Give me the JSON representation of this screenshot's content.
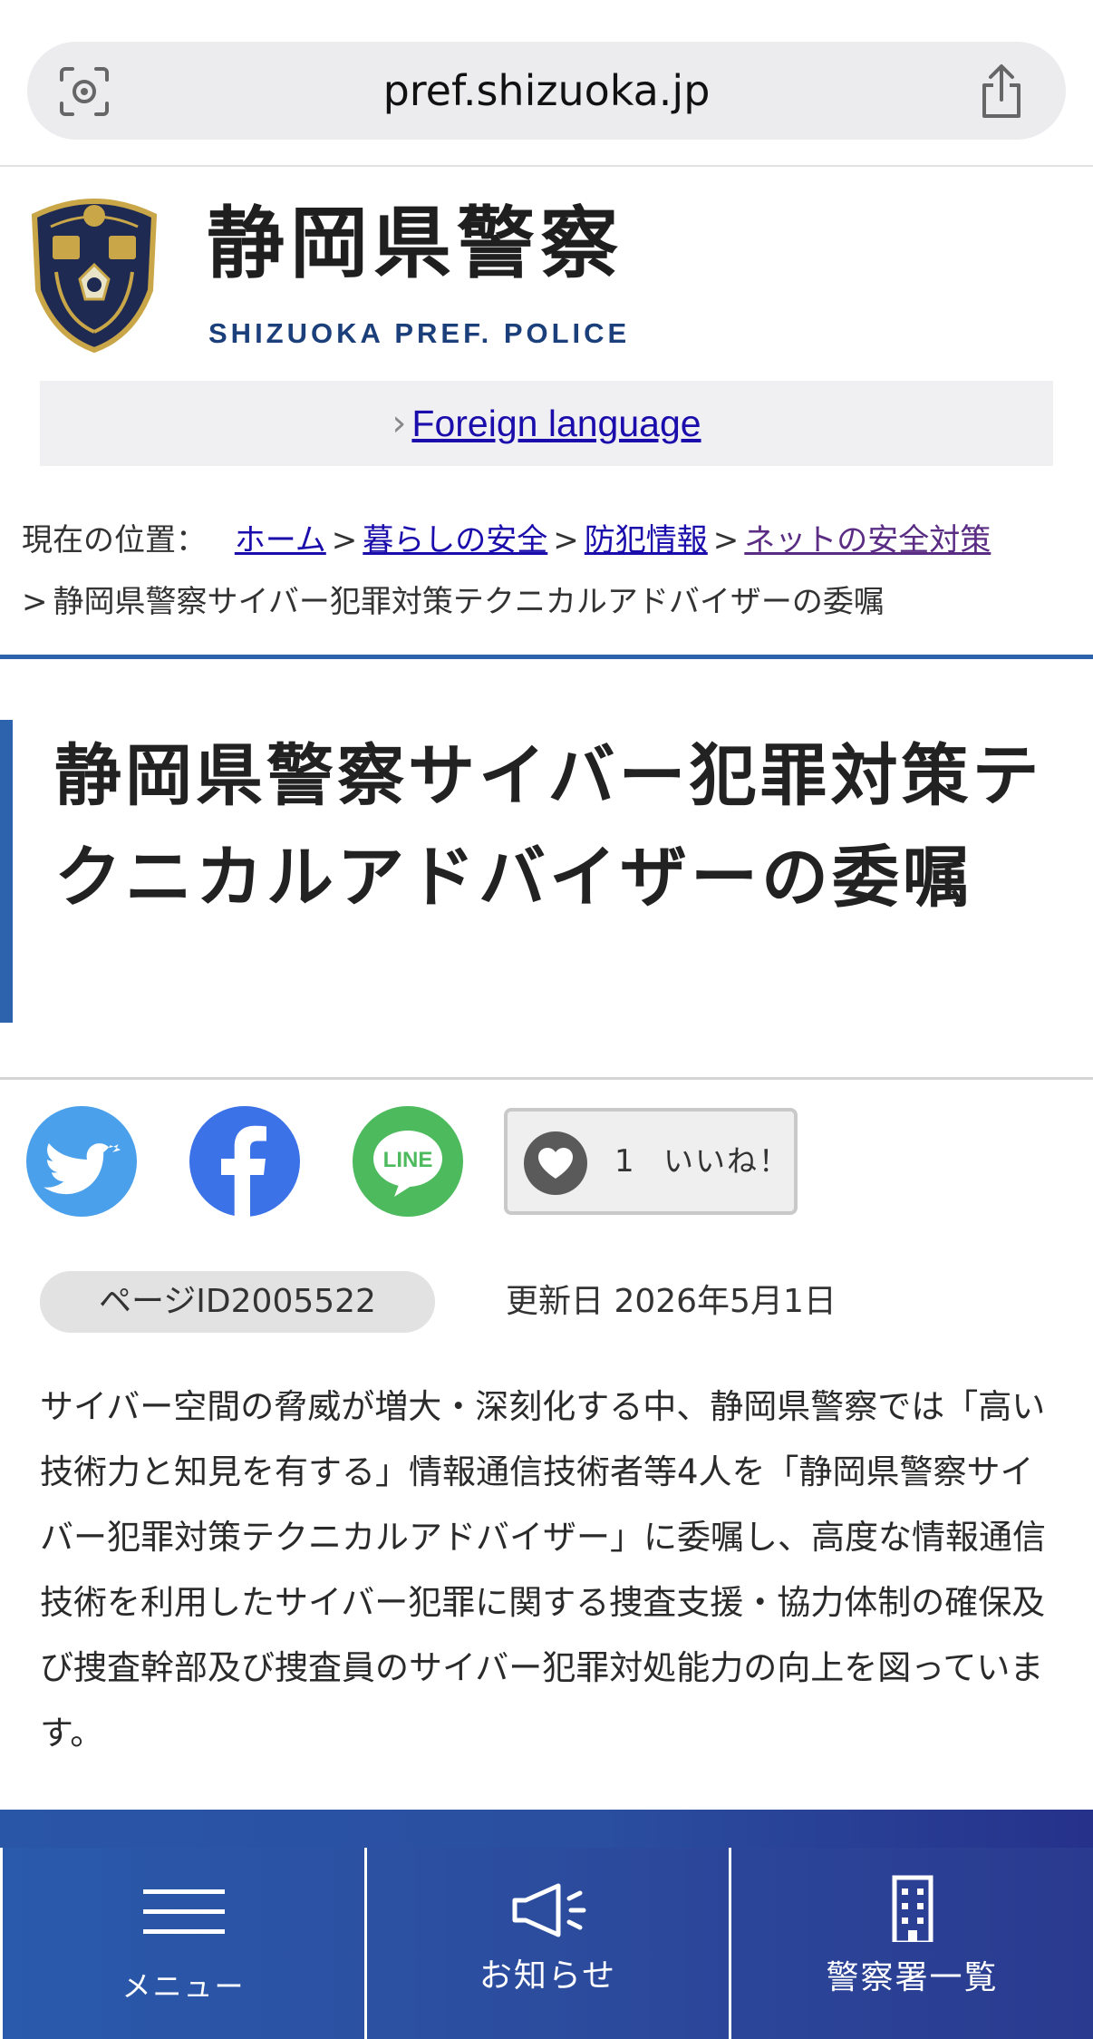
{
  "browser": {
    "url": "pref.shizuoka.jp",
    "lens_icon": "visual-lookup-icon",
    "share_icon": "share-icon"
  },
  "header": {
    "site_name": "静岡県警察",
    "site_name_en": "SHIZUOKA PREF. POLICE",
    "logo_icon": "police-emblem-icon",
    "foreign_language": "Foreign language"
  },
  "breadcrumb": {
    "prefix": "現在の位置：",
    "sep": ">",
    "items": [
      "ホーム",
      "暮らしの安全",
      "防犯情報",
      "ネットの安全対策"
    ],
    "current": "静岡県警察サイバー犯罪対策テクニカルアドバイザーの委嘱"
  },
  "page": {
    "title": "静岡県警察サイバー犯罪対策テクニカルアドバイザーの委嘱",
    "like_count": "1",
    "like_label": "いいね！",
    "page_id": "ページID2005522",
    "updated": "更新日 2026年5月1日",
    "body": "サイバー空間の脅威が増大・深刻化する中、静岡県警察では「高い技術力と知見を有する」情報通信技術者等4人を「静岡県警察サイバー犯罪対策テクニカルアドバイザー」に委嘱し、高度な情報通信技術を利用したサイバー犯罪に関する捜査支援・協力体制の確保及び捜査幹部及び捜査員のサイバー犯罪対処能力の向上を図っています。"
  },
  "social": {
    "twitter": "twitter-icon",
    "facebook": "facebook-icon",
    "line": "line-icon",
    "line_text": "LINE"
  },
  "bottom_nav": {
    "menu": "メニュー",
    "news": "お知らせ",
    "stations": "警察署一覧"
  },
  "colors": {
    "accent": "#2d62ad",
    "link": "#1a0dab",
    "nav_bg": "#2c4c9e"
  }
}
